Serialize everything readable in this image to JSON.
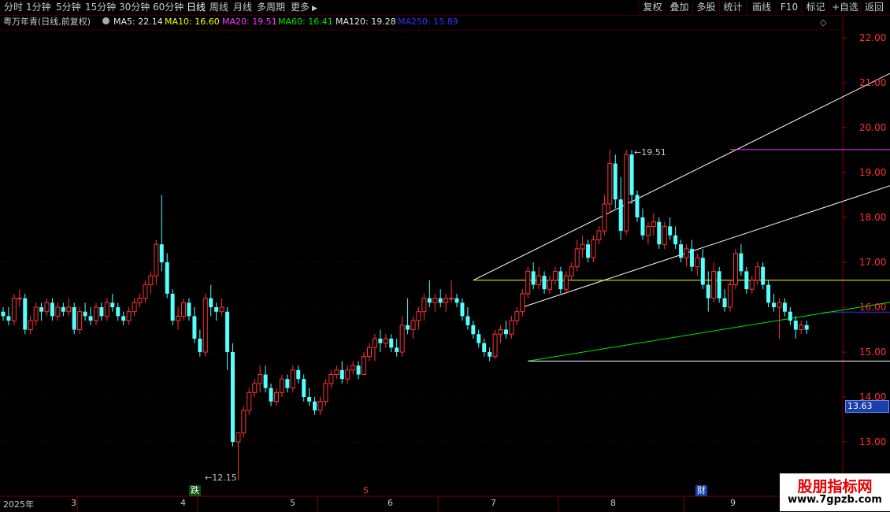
{
  "toolbar": {
    "periods": [
      "分时",
      "1分钟",
      "5分钟",
      "15分钟",
      "30分钟",
      "60分钟",
      "日线",
      "周线",
      "月线",
      "多周期",
      "更多"
    ],
    "active_period": "日线",
    "more_arrow": "▶",
    "right_buttons": [
      "复权",
      "叠加",
      "多股",
      "统计",
      "画线",
      "F10",
      "标记",
      "+自选",
      "返回"
    ]
  },
  "info": {
    "title": "粤万年青(日线,前复权)",
    "ma5": "MA5: 22.14",
    "ma10": "MA10: 16.60",
    "ma20": "MA20: 19.51",
    "ma60": "MA60: 16.41",
    "ma120": "MA120: 19.28",
    "ma250": "MA250: 15.89",
    "colors": {
      "ma5": "#e8e8e8",
      "ma10": "#ffff00",
      "ma20": "#ff33ff",
      "ma60": "#00e600",
      "ma120": "#e8e8e8",
      "ma250": "#3333ff"
    }
  },
  "annotations": {
    "high_label": "19.51",
    "low_label": "12.15",
    "current_price": "13.63",
    "marker_die": "跌",
    "marker_s": "S",
    "marker_cai": "财"
  },
  "time_axis": {
    "year": "2025年",
    "months": [
      "3",
      "4",
      "5",
      "6",
      "7",
      "8",
      "9"
    ]
  },
  "watermark": {
    "title": "股朋指标网",
    "url": "www.7gpzb.com"
  },
  "chart_data": {
    "type": "candlestick",
    "ylim": [
      12.0,
      22.2
    ],
    "y_ticks": [
      13.0,
      14.0,
      15.0,
      16.0,
      17.0,
      18.0,
      19.0,
      20.0,
      21.0,
      22.0
    ],
    "up_color": "#ff3232",
    "down_color": "#54ffff",
    "candles": [
      [
        15.9,
        16.0,
        15.7,
        15.8
      ],
      [
        15.8,
        16.0,
        15.6,
        15.7
      ],
      [
        15.7,
        16.3,
        15.6,
        16.2
      ],
      [
        16.2,
        16.4,
        16.0,
        16.2
      ],
      [
        16.2,
        16.3,
        15.4,
        15.5
      ],
      [
        15.5,
        15.8,
        15.4,
        15.7
      ],
      [
        15.7,
        16.1,
        15.6,
        16.0
      ],
      [
        16.0,
        16.1,
        15.7,
        15.9
      ],
      [
        15.9,
        16.2,
        15.8,
        16.1
      ],
      [
        16.1,
        16.2,
        15.7,
        15.8
      ],
      [
        15.8,
        16.1,
        15.7,
        16.0
      ],
      [
        16.0,
        16.1,
        15.8,
        15.9
      ],
      [
        15.9,
        16.2,
        15.8,
        16.0
      ],
      [
        16.0,
        16.1,
        15.4,
        15.5
      ],
      [
        15.5,
        16.0,
        15.4,
        15.9
      ],
      [
        15.9,
        16.1,
        15.7,
        15.8
      ],
      [
        15.8,
        16.0,
        15.6,
        15.7
      ],
      [
        15.7,
        16.1,
        15.6,
        16.0
      ],
      [
        16.0,
        16.1,
        15.7,
        15.8
      ],
      [
        15.8,
        16.2,
        15.7,
        16.1
      ],
      [
        16.1,
        16.3,
        15.9,
        16.0
      ],
      [
        16.0,
        16.1,
        15.7,
        15.8
      ],
      [
        15.8,
        15.9,
        15.6,
        15.7
      ],
      [
        15.7,
        16.0,
        15.6,
        15.9
      ],
      [
        15.9,
        16.2,
        15.8,
        16.1
      ],
      [
        16.1,
        16.3,
        16.0,
        16.2
      ],
      [
        16.2,
        16.6,
        16.1,
        16.5
      ],
      [
        16.5,
        16.8,
        16.3,
        16.7
      ],
      [
        16.7,
        17.5,
        16.5,
        17.4
      ],
      [
        17.4,
        18.5,
        16.8,
        17.0
      ],
      [
        17.0,
        17.2,
        16.2,
        16.3
      ],
      [
        16.3,
        16.4,
        15.6,
        15.7
      ],
      [
        15.7,
        16.0,
        15.5,
        15.8
      ],
      [
        15.8,
        16.2,
        15.7,
        16.1
      ],
      [
        16.1,
        16.2,
        15.7,
        15.8
      ],
      [
        15.8,
        16.0,
        15.2,
        15.3
      ],
      [
        15.3,
        15.5,
        14.9,
        15.0
      ],
      [
        15.0,
        16.3,
        14.9,
        16.2
      ],
      [
        16.2,
        16.5,
        15.8,
        16.0
      ],
      [
        16.0,
        16.1,
        15.7,
        15.9
      ],
      [
        15.9,
        16.2,
        15.8,
        16.0
      ],
      [
        15.9,
        16.0,
        14.6,
        15.0
      ],
      [
        15.0,
        15.2,
        12.9,
        13.0
      ],
      [
        13.0,
        13.2,
        12.15,
        13.2
      ],
      [
        13.2,
        13.8,
        13.1,
        13.7
      ],
      [
        13.7,
        14.2,
        13.6,
        14.1
      ],
      [
        14.1,
        14.4,
        14.0,
        14.3
      ],
      [
        14.3,
        14.7,
        14.1,
        14.5
      ],
      [
        14.5,
        14.7,
        14.1,
        14.2
      ],
      [
        14.2,
        14.3,
        13.8,
        13.9
      ],
      [
        13.9,
        14.2,
        13.8,
        14.1
      ],
      [
        14.1,
        14.5,
        14.0,
        14.4
      ],
      [
        14.4,
        14.5,
        14.1,
        14.2
      ],
      [
        14.2,
        14.7,
        14.1,
        14.6
      ],
      [
        14.6,
        14.7,
        14.3,
        14.4
      ],
      [
        14.4,
        14.5,
        13.9,
        14.0
      ],
      [
        14.0,
        14.2,
        13.8,
        13.9
      ],
      [
        13.9,
        14.0,
        13.6,
        13.7
      ],
      [
        13.7,
        14.0,
        13.6,
        13.9
      ],
      [
        13.9,
        14.4,
        13.8,
        14.3
      ],
      [
        14.3,
        14.6,
        14.2,
        14.5
      ],
      [
        14.5,
        14.7,
        14.4,
        14.6
      ],
      [
        14.6,
        14.8,
        14.3,
        14.4
      ],
      [
        14.4,
        14.7,
        14.3,
        14.6
      ],
      [
        14.6,
        14.8,
        14.5,
        14.7
      ],
      [
        14.7,
        14.8,
        14.4,
        14.5
      ],
      [
        14.5,
        15.0,
        14.5,
        14.9
      ],
      [
        14.9,
        15.2,
        14.8,
        15.1
      ],
      [
        15.1,
        15.4,
        14.8,
        15.3
      ],
      [
        15.3,
        15.5,
        15.0,
        15.2
      ],
      [
        15.2,
        15.4,
        15.1,
        15.3
      ],
      [
        15.3,
        15.4,
        15.0,
        15.1
      ],
      [
        15.1,
        15.3,
        14.9,
        15.0
      ],
      [
        15.0,
        15.8,
        14.9,
        15.6
      ],
      [
        15.6,
        16.2,
        15.4,
        15.5
      ],
      [
        15.5,
        15.8,
        15.3,
        15.7
      ],
      [
        15.7,
        16.0,
        15.5,
        15.9
      ],
      [
        15.9,
        16.3,
        15.7,
        16.2
      ],
      [
        16.2,
        16.6,
        16.0,
        16.1
      ],
      [
        16.1,
        16.3,
        15.9,
        16.2
      ],
      [
        16.2,
        16.4,
        16.0,
        16.1
      ],
      [
        16.1,
        16.3,
        15.9,
        16.2
      ],
      [
        16.2,
        16.6,
        16.1,
        16.2
      ],
      [
        16.2,
        16.3,
        16.0,
        16.1
      ],
      [
        16.1,
        16.2,
        15.7,
        15.8
      ],
      [
        15.8,
        16.0,
        15.5,
        15.6
      ],
      [
        15.6,
        15.7,
        15.3,
        15.4
      ],
      [
        15.4,
        15.5,
        15.1,
        15.2
      ],
      [
        15.2,
        15.3,
        14.9,
        15.0
      ],
      [
        15.0,
        15.1,
        14.8,
        14.9
      ],
      [
        14.9,
        15.5,
        14.85,
        15.4
      ],
      [
        15.4,
        15.6,
        15.2,
        15.5
      ],
      [
        15.5,
        15.7,
        15.3,
        15.4
      ],
      [
        15.4,
        15.8,
        15.3,
        15.7
      ],
      [
        15.7,
        16.0,
        15.6,
        15.9
      ],
      [
        15.9,
        16.4,
        15.8,
        16.3
      ],
      [
        16.3,
        16.9,
        16.2,
        16.8
      ],
      [
        16.8,
        17.0,
        16.4,
        16.5
      ],
      [
        16.5,
        16.9,
        16.4,
        16.7
      ],
      [
        16.7,
        16.8,
        16.3,
        16.4
      ],
      [
        16.4,
        16.7,
        16.3,
        16.6
      ],
      [
        16.6,
        16.9,
        16.5,
        16.8
      ],
      [
        16.8,
        16.9,
        16.3,
        16.4
      ],
      [
        16.4,
        16.8,
        16.3,
        16.7
      ],
      [
        16.7,
        17.0,
        16.6,
        16.9
      ],
      [
        16.9,
        17.5,
        16.8,
        17.3
      ],
      [
        17.3,
        17.6,
        17.1,
        17.4
      ],
      [
        17.4,
        17.5,
        17.0,
        17.1
      ],
      [
        17.1,
        17.6,
        17.0,
        17.5
      ],
      [
        17.5,
        17.8,
        17.4,
        17.7
      ],
      [
        17.7,
        18.5,
        17.6,
        18.3
      ],
      [
        18.3,
        19.51,
        18.1,
        19.2
      ],
      [
        19.2,
        19.4,
        18.2,
        18.4
      ],
      [
        18.4,
        18.9,
        17.5,
        17.7
      ],
      [
        17.7,
        19.51,
        17.6,
        19.4
      ],
      [
        19.4,
        19.5,
        18.3,
        18.5
      ],
      [
        18.5,
        18.6,
        17.9,
        18.0
      ],
      [
        18.0,
        18.2,
        17.5,
        17.6
      ],
      [
        17.6,
        17.9,
        17.4,
        17.8
      ],
      [
        17.8,
        18.1,
        17.6,
        17.9
      ],
      [
        17.9,
        18.0,
        17.3,
        17.4
      ],
      [
        17.4,
        17.9,
        17.3,
        17.8
      ],
      [
        17.8,
        18.0,
        17.5,
        17.6
      ],
      [
        17.6,
        17.8,
        17.3,
        17.4
      ],
      [
        17.4,
        17.5,
        17.0,
        17.1
      ],
      [
        17.1,
        17.4,
        16.9,
        17.3
      ],
      [
        17.3,
        17.5,
        16.8,
        16.9
      ],
      [
        16.9,
        17.2,
        16.7,
        17.1
      ],
      [
        17.1,
        17.3,
        16.4,
        16.5
      ],
      [
        16.5,
        16.8,
        15.9,
        16.2
      ],
      [
        16.2,
        17.0,
        16.1,
        16.8
      ],
      [
        16.8,
        16.9,
        16.1,
        16.2
      ],
      [
        16.2,
        16.4,
        15.9,
        16.0
      ],
      [
        16.0,
        16.6,
        15.9,
        16.5
      ],
      [
        16.5,
        17.3,
        16.4,
        17.2
      ],
      [
        17.2,
        17.4,
        16.7,
        16.8
      ],
      [
        16.8,
        16.9,
        16.3,
        16.4
      ],
      [
        16.4,
        16.7,
        16.3,
        16.6
      ],
      [
        16.6,
        17.0,
        16.5,
        16.9
      ],
      [
        16.9,
        17.0,
        16.4,
        16.5
      ],
      [
        16.5,
        16.6,
        16.0,
        16.1
      ],
      [
        16.1,
        16.3,
        15.9,
        16.0
      ],
      [
        16.0,
        16.2,
        15.3,
        16.1
      ],
      [
        16.1,
        16.2,
        15.8,
        15.9
      ],
      [
        15.9,
        16.0,
        15.6,
        15.7
      ],
      [
        15.7,
        15.8,
        15.3,
        15.5
      ],
      [
        15.5,
        15.7,
        15.4,
        15.6
      ],
      [
        15.6,
        15.7,
        15.4,
        15.5
      ]
    ],
    "drawn_lines": [
      {
        "color": "#ffffff",
        "from": [
          86,
          16.6
        ],
        "to": [
          177,
          22.1
        ]
      },
      {
        "color": "#ffffff",
        "from": [
          95,
          16.0
        ],
        "to": [
          177,
          19.3
        ]
      },
      {
        "color": "#ffff00",
        "from": [
          86,
          16.6
        ],
        "to": [
          177,
          16.6
        ]
      },
      {
        "color": "#ff33ff",
        "from": [
          133,
          19.51
        ],
        "to": [
          177,
          19.51
        ]
      },
      {
        "color": "#3333ff",
        "from": [
          150,
          15.89
        ],
        "to": [
          177,
          15.89
        ]
      },
      {
        "color": "#00e600",
        "from": [
          96,
          14.8
        ],
        "to": [
          177,
          16.4
        ]
      },
      {
        "color": "#ffffff",
        "from": [
          96,
          14.8
        ],
        "to": [
          177,
          14.8
        ]
      }
    ],
    "month_bars": [
      14,
      36,
      58,
      80,
      102,
      125,
      147
    ]
  }
}
